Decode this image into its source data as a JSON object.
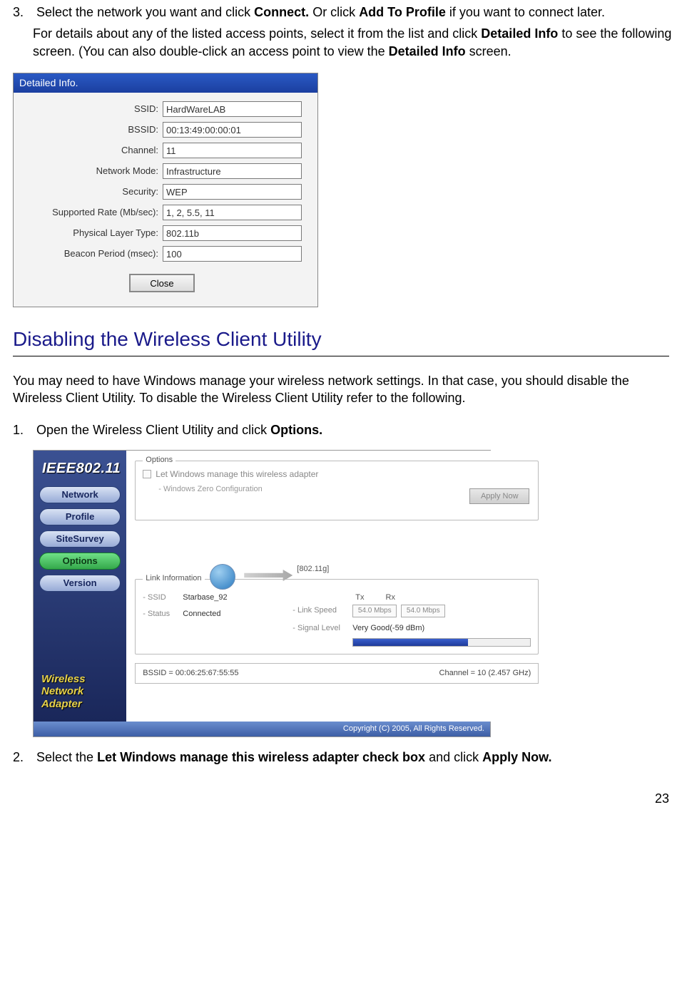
{
  "step3": {
    "num": "3.",
    "text_a": "Select the network you want and click ",
    "bold_connect": "Connect.",
    "text_b": " Or click ",
    "bold_add": "Add To Profile",
    "text_c": " if you want to connect later.",
    "para2_a": "For details about any of the listed access points, select it from the list and click ",
    "bold_detailed1": "Detailed Info",
    "para2_b": " to see the following screen. (You can also double-click an access point to view the ",
    "bold_detailed2": "Detailed Info",
    "para2_c": " screen."
  },
  "di": {
    "title": "Detailed Info.",
    "fields": {
      "ssid": {
        "label": "SSID:",
        "value": "HardWareLAB"
      },
      "bssid": {
        "label": "BSSID:",
        "value": "00:13:49:00:00:01"
      },
      "channel": {
        "label": "Channel:",
        "value": "11"
      },
      "mode": {
        "label": "Network Mode:",
        "value": "Infrastructure"
      },
      "security": {
        "label": "Security:",
        "value": "WEP"
      },
      "rate": {
        "label": "Supported Rate (Mb/sec):",
        "value": "1, 2, 5.5, 11"
      },
      "phy": {
        "label": "Physical Layer Type:",
        "value": "802.11b"
      },
      "beacon": {
        "label": "Beacon Period (msec):",
        "value": "100"
      }
    },
    "close": "Close"
  },
  "section": {
    "heading": "Disabling the Wireless Client Utility",
    "para": "You may need to have Windows manage your wireless network settings. In that case, you should disable the Wireless Client Utility. To disable the Wireless Client Utility refer to the following."
  },
  "step1": {
    "num": "1.",
    "text_a": "Open the Wireless Client Utility and click ",
    "bold_options": "Options."
  },
  "wcu": {
    "logo": "IEEE802.11",
    "tabs": {
      "network": "Network",
      "profile": "Profile",
      "sitesurvey": "SiteSurvey",
      "options": "Options",
      "version": "Version"
    },
    "sidebar_label_1": "Wireless",
    "sidebar_label_2": "Network Adapter",
    "options_box": {
      "legend": "Options",
      "checkbox": "Let Windows manage this wireless adapter",
      "sub": "- Windows Zero Configuration",
      "apply": "Apply Now"
    },
    "link_box": {
      "legend": "Link Information",
      "proto": "[802.11g]",
      "ssid_k": "- SSID",
      "ssid_v": "Starbase_92",
      "status_k": "- Status",
      "status_v": "Connected",
      "tx": "Tx",
      "rx": "Rx",
      "speed_k": "- Link Speed",
      "tx_val": "54.0 Mbps",
      "rx_val": "54.0 Mbps",
      "sig_k": "- Signal Level",
      "sig_v": "Very Good(-59 dBm)"
    },
    "status_bar": {
      "bssid": "BSSID = 00:06:25:67:55:55",
      "channel": "Channel = 10 (2.457 GHz)"
    },
    "footer": "Copyright (C) 2005, All Rights Reserved."
  },
  "step2": {
    "num": "2.",
    "text_a": "Select the ",
    "bold_let": "Let Windows manage this wireless adapter check box",
    "text_b": " and click ",
    "bold_apply": "Apply Now."
  },
  "page_number": "23"
}
